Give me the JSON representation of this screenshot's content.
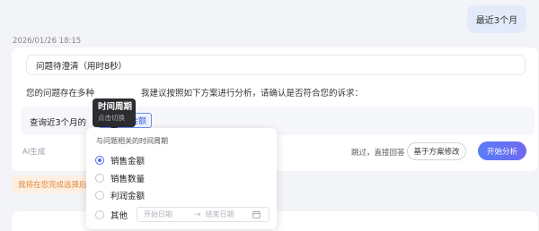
{
  "user_message": "最近3个月",
  "timestamp": "2026/01/26 18:15",
  "card": {
    "question_title": "问题待澄清（用时8秒）",
    "intro_left": "您的问题存在多种",
    "intro_right": "我建议按照如下方案进行分析，请确认是否符合您的诉求：",
    "query_prefix": "查询近3个月的",
    "metric_chip": "销售金额",
    "ai_tag": "AI生成",
    "skip_text": "跳过，直接回答",
    "modify_button": "基于方案修改",
    "start_button": "开始分析"
  },
  "notice": "我将在您完成选择后",
  "tooltip": {
    "title": "时间周期",
    "subtitle": "点击切换"
  },
  "dropdown": {
    "header": "与问题相关的时间周期",
    "options": [
      {
        "label": "销售金额",
        "selected": true
      },
      {
        "label": "销售数量",
        "selected": false
      },
      {
        "label": "利润金额",
        "selected": false
      },
      {
        "label": "其他",
        "selected": false
      }
    ],
    "date_start_placeholder": "开始日期",
    "date_arrow": "→",
    "date_end_placeholder": "结束日期"
  },
  "colors": {
    "accent": "#4a6cf0",
    "chip_text": "#3b5ee8",
    "notice_text": "#e0893a",
    "notice_bg": "#fdf0e3",
    "tooltip_bg": "#2c2d30"
  },
  "icons": {
    "chip_icon": "calendar-icon",
    "date_icon": "calendar-icon"
  }
}
